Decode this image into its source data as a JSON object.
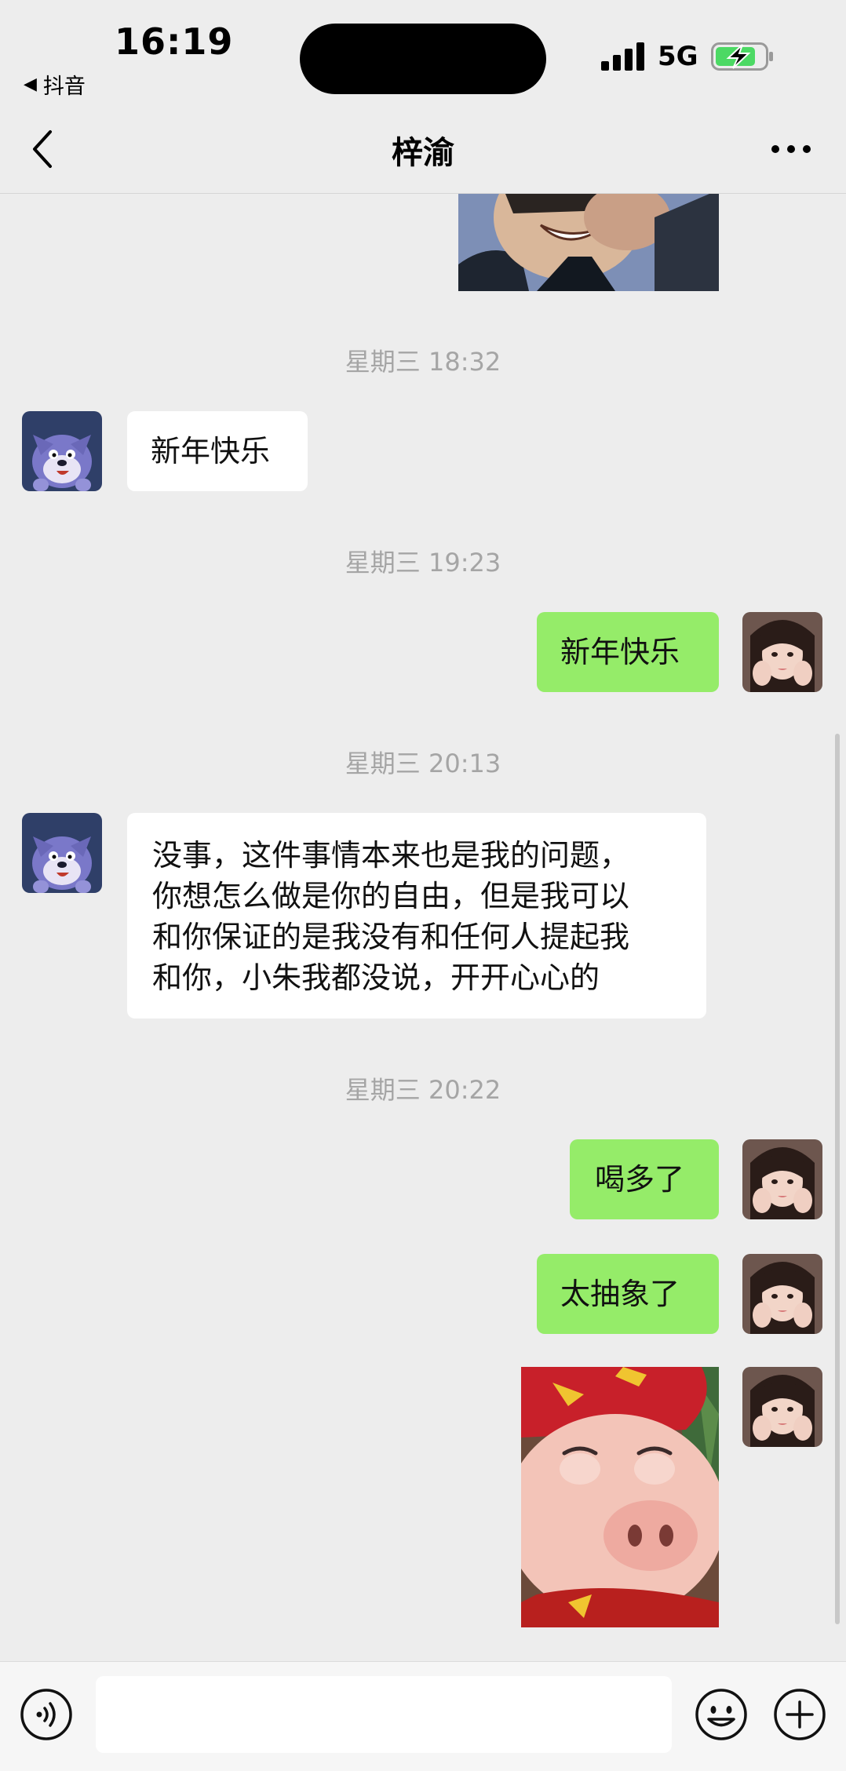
{
  "status_bar": {
    "time": "16:19",
    "back_app": "抖音",
    "network": "5G"
  },
  "nav": {
    "title": "梓渝"
  },
  "messages": [
    {
      "type": "timestamp",
      "text": "星期三 18:32"
    },
    {
      "type": "text",
      "side": "in",
      "text": "新年快乐"
    },
    {
      "type": "timestamp",
      "text": "星期三 19:23"
    },
    {
      "type": "text",
      "side": "out",
      "text": "新年快乐"
    },
    {
      "type": "timestamp",
      "text": "星期三 20:13"
    },
    {
      "type": "text",
      "side": "in",
      "lines": [
        "没事，这件事情本来也是我的问题，",
        "你想怎么做是你的自由，但是我可以",
        "和你保证的是我没有和任何人提起我",
        "和你，小朱我都没说，开开心心的"
      ]
    },
    {
      "type": "timestamp",
      "text": "星期三 20:22"
    },
    {
      "type": "text",
      "side": "out",
      "text": "喝多了"
    },
    {
      "type": "text",
      "side": "out",
      "text": "太抽象了"
    },
    {
      "type": "image",
      "side": "out"
    }
  ],
  "input": {
    "value": "",
    "placeholder": ""
  },
  "icons": {
    "voice": "voice-icon",
    "emoji": "emoji-icon",
    "plus": "plus-icon",
    "back": "chevron-left-icon",
    "more": "more-icon"
  },
  "colors": {
    "background": "#ededed",
    "outgoing_bubble": "#95ec69",
    "incoming_bubble": "#ffffff",
    "battery_charging": "#4cd964"
  }
}
